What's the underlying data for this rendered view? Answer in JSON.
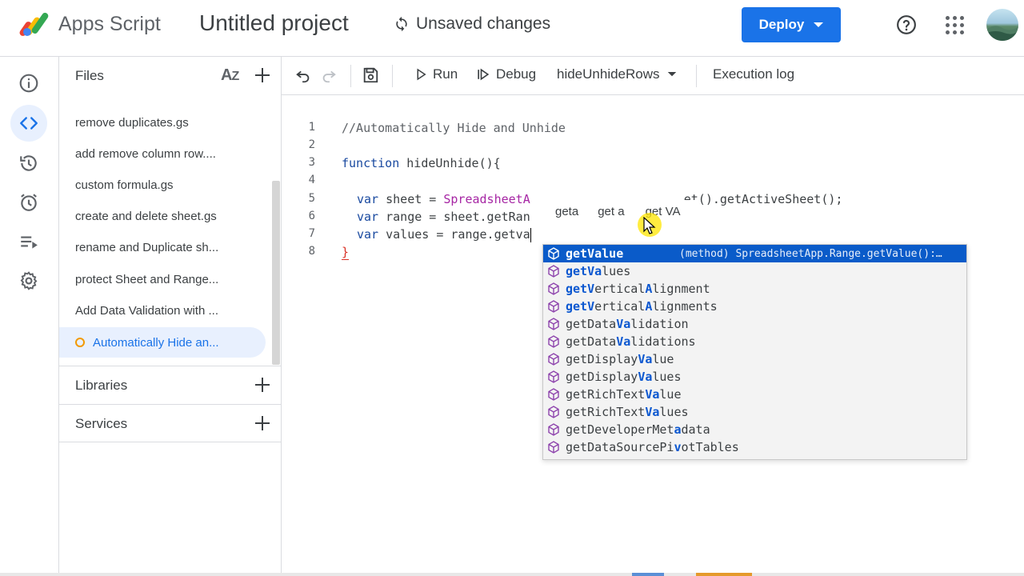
{
  "header": {
    "app_name": "Apps Script",
    "project_title": "Untitled project",
    "status": "Unsaved changes",
    "deploy_label": "Deploy"
  },
  "files_panel": {
    "title": "Files",
    "files": [
      "remove duplicates.gs",
      "add remove column row....",
      "custom formula.gs",
      "create and delete sheet.gs",
      "rename and Duplicate sh...",
      "protect Sheet and Range...",
      "Add Data Validation with ...",
      "Automatically Hide an..."
    ],
    "active_file": "Automatically Hide an...",
    "libraries_label": "Libraries",
    "services_label": "Services"
  },
  "toolbar": {
    "run_label": "Run",
    "debug_label": "Debug",
    "function_selected": "hideUnhideRows",
    "execution_log_label": "Execution log"
  },
  "editor": {
    "line_numbers": [
      "1",
      "2",
      "3",
      "4",
      "5",
      "6",
      "7",
      "8"
    ],
    "lines": {
      "l1": "//Automatically Hide and Unhide",
      "l3_kw": "function",
      "l3_rest": " hideUnhide(){",
      "l5_kw": "var",
      "l5_a": " sheet = ",
      "l5_cls": "SpreadsheetA",
      "l5_b": "et().getActiveSheet();",
      "l6_kw": "var",
      "l6_a": " range = sheet.getRan",
      "l7_kw": "var",
      "l7_a": " values = range.getva",
      "l8": "}"
    },
    "suggestion_chips": [
      "geta",
      "get a",
      "get VA"
    ]
  },
  "autocomplete": {
    "items": [
      {
        "pre": "get",
        "hl": "Value",
        "post": "",
        "selected": true
      },
      {
        "pre": "get",
        "hl": "Va",
        "post": "lues",
        "selected": false
      },
      {
        "pre": "get",
        "hl": "V",
        "post": "ertical",
        "hl2": "A",
        "post2": "lignment",
        "selected": false
      },
      {
        "pre": "get",
        "hl": "V",
        "post": "ertical",
        "hl2": "A",
        "post2": "lignments",
        "selected": false
      },
      {
        "pre": "getData",
        "hl": "Va",
        "post": "lidation",
        "selected": false
      },
      {
        "pre": "getData",
        "hl": "Va",
        "post": "lidations",
        "selected": false
      },
      {
        "pre": "getDisplay",
        "hl": "Va",
        "post": "lue",
        "selected": false
      },
      {
        "pre": "getDisplay",
        "hl": "Va",
        "post": "lues",
        "selected": false
      },
      {
        "pre": "getRichText",
        "hl": "Va",
        "post": "lue",
        "selected": false
      },
      {
        "pre": "getRichText",
        "hl": "Va",
        "post": "lues",
        "selected": false
      },
      {
        "pre": "getDeveloperMet",
        "hl": "a",
        "post": "data",
        "selected": false
      },
      {
        "pre": "getDataSourcePi",
        "hl": "v",
        "post": "otTables",
        "selected": false
      }
    ],
    "selected_detail": "(method) SpreadsheetApp.Range.getValue():…"
  }
}
